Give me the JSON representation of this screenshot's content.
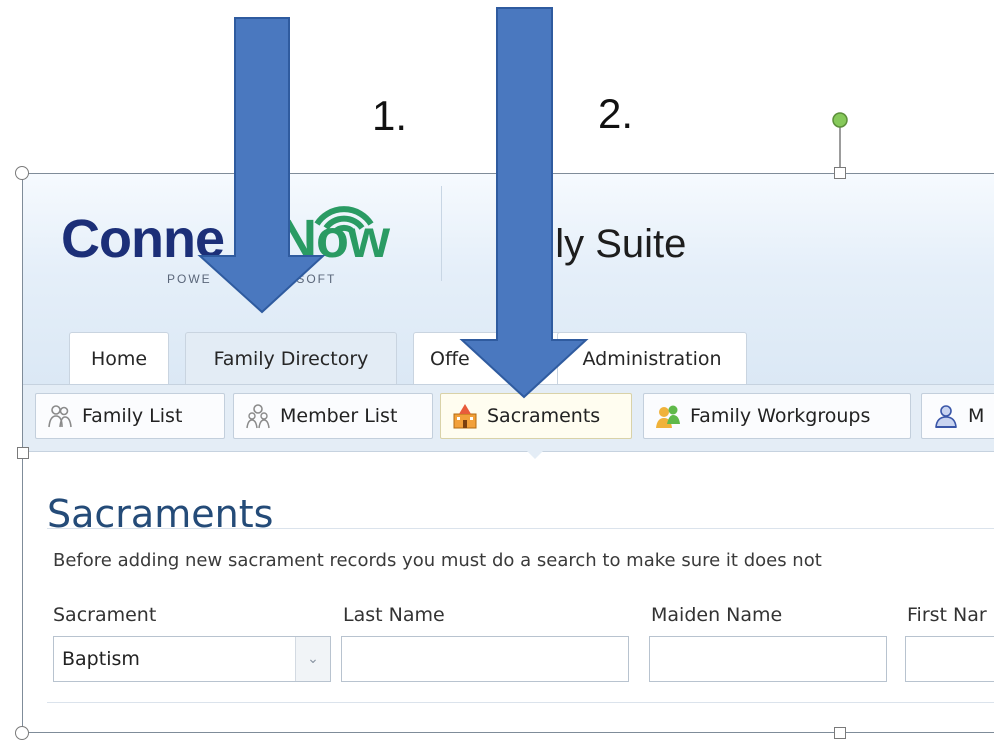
{
  "annotations": {
    "step1": "1.",
    "step2": "2."
  },
  "app": {
    "logo_text_a": "Conne",
    "logo_text_b": "Now",
    "logo_sub": "POWE",
    "logo_sub_b": "ARISHSOFT",
    "suite_title": "mily Suite"
  },
  "tabs": [
    {
      "label": "Home"
    },
    {
      "label": "Family Directory",
      "active": true
    },
    {
      "label": "Offe"
    },
    {
      "label": "Administration"
    }
  ],
  "subnav": [
    {
      "label": "Family List",
      "icon": "family-list-icon"
    },
    {
      "label": "Member List",
      "icon": "member-list-icon"
    },
    {
      "label": "Sacraments",
      "icon": "church-icon",
      "active": true
    },
    {
      "label": "Family Workgroups",
      "icon": "workgroup-icon"
    },
    {
      "label": "M",
      "icon": "user-icon"
    }
  ],
  "page": {
    "title": "Sacraments",
    "intro": "Before adding new sacrament records you must do a search to make sure it does not"
  },
  "form": {
    "sacrament_label": "Sacrament",
    "sacrament_value": "Baptism",
    "last_name_label": "Last Name",
    "maiden_name_label": "Maiden Name",
    "first_name_label": "First Nar"
  },
  "colors": {
    "arrow": "#4a78bf",
    "logo_blue": "#1c2f78",
    "logo_green": "#2a9b63",
    "title_blue": "#244b78"
  }
}
